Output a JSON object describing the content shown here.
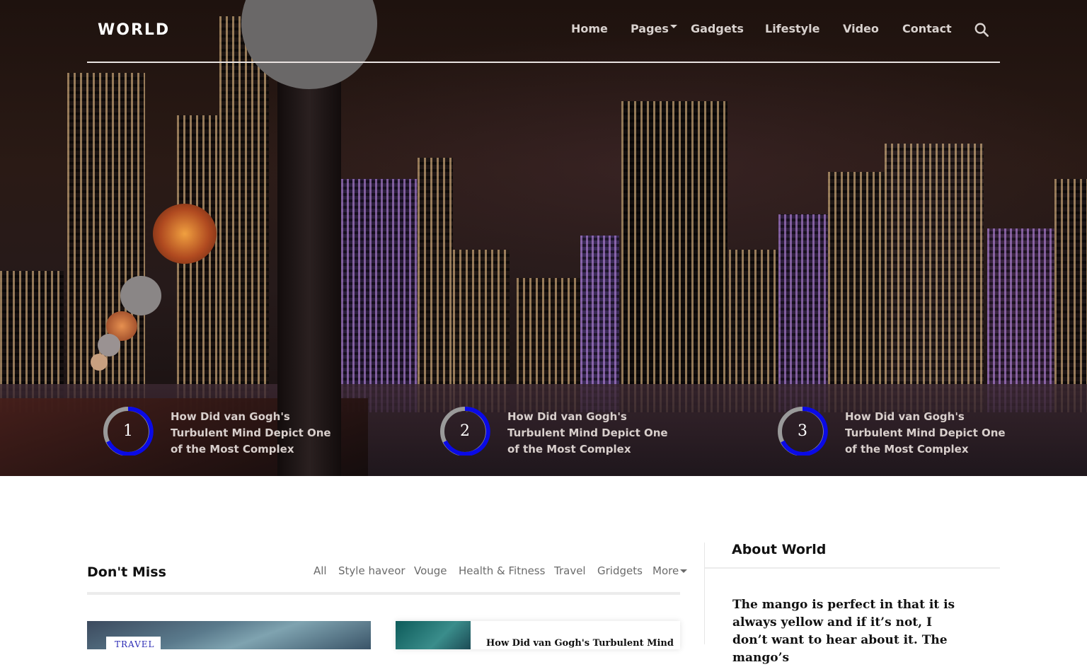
{
  "header": {
    "logo": "WORLD",
    "nav": [
      {
        "label": "Home"
      },
      {
        "label": "Pages"
      },
      {
        "label": "Gadgets"
      },
      {
        "label": "Lifestyle"
      },
      {
        "label": "Video"
      },
      {
        "label": "Contact"
      }
    ],
    "search_icon": "search-icon"
  },
  "featured": [
    {
      "number": "1",
      "title": "How Did van Gogh's Turbulent Mind Depict One of the Most Complex"
    },
    {
      "number": "2",
      "title": "How Did van Gogh's Turbulent Mind Depict One of the Most Complex"
    },
    {
      "number": "3",
      "title": "How Did van Gogh's Turbulent Mind Depict One of the Most Complex"
    }
  ],
  "dont_miss": {
    "title": "Don't Miss",
    "tabs": [
      "All",
      "Style haveor",
      "Vouge",
      "Health & Fitness",
      "Travel",
      "Gridgets",
      "More"
    ],
    "card1_tag": "TRAVEL",
    "card2_title": "How Did van Gogh's Turbulent Mind"
  },
  "sidebar": {
    "title": "About World",
    "text": "The mango is perfect in that it is always yellow and if it’s not, I don’t want to hear about it. The mango’s"
  },
  "colors": {
    "ring_accent": "#0a0ae6",
    "ring_track": "#9a9a9a"
  }
}
